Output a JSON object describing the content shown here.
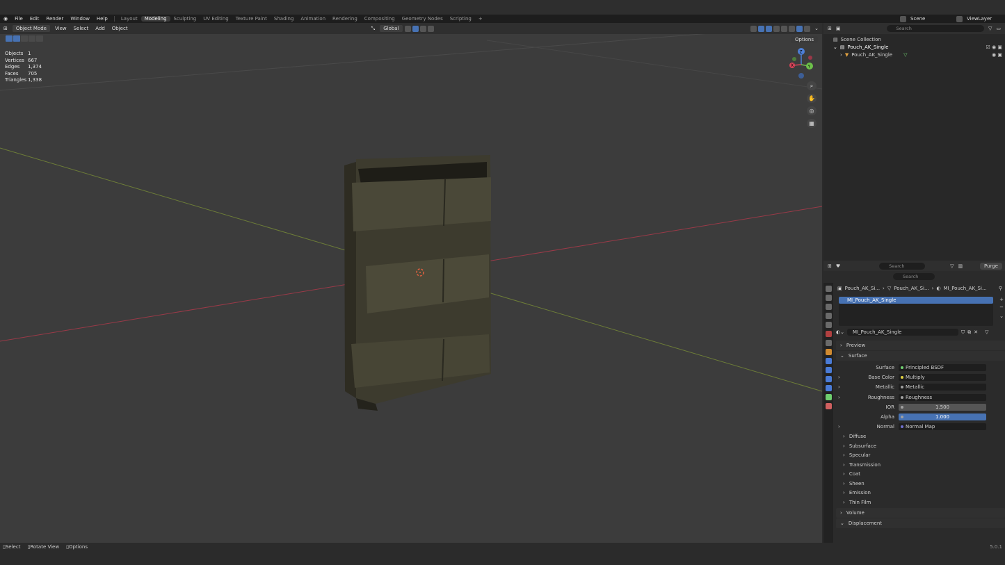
{
  "menubar": {
    "menus": [
      "File",
      "Edit",
      "Render",
      "Window",
      "Help"
    ],
    "workspaces": [
      "Layout",
      "Modeling",
      "Sculpting",
      "UV Editing",
      "Texture Paint",
      "Shading",
      "Animation",
      "Rendering",
      "Compositing",
      "Geometry Nodes",
      "Scripting"
    ],
    "active_workspace": "Modeling",
    "add_tab": "+",
    "scene": "Scene",
    "view_layer": "ViewLayer"
  },
  "viewport": {
    "mode": "Object Mode",
    "menus": [
      "View",
      "Select",
      "Add",
      "Object"
    ],
    "orientation": "Global",
    "options": "Options",
    "stats": [
      {
        "k": "Objects",
        "v": "1"
      },
      {
        "k": "Vertices",
        "v": "667"
      },
      {
        "k": "Edges",
        "v": "1,374"
      },
      {
        "k": "Faces",
        "v": "705"
      },
      {
        "k": "Triangles",
        "v": "1,338"
      }
    ],
    "gizmo_labels": {
      "z": "Z",
      "y": "Y",
      "x": "X"
    },
    "nav_icons": [
      "zoom-icon",
      "hand-pan-icon",
      "camera-icon",
      "grid-ortho-icon"
    ]
  },
  "outliner": {
    "search_placeholder": "Search",
    "scene_collection": "Scene Collection",
    "collection": "Pouch_AK_Single",
    "object": "Pouch_AK_Single"
  },
  "properties": {
    "search_placeholder": "Search",
    "purge": "Purge",
    "search2": "Search",
    "breadcrumb": [
      "Pouch_AK_Si...",
      "Pouch_AK_Si...",
      "MI_Pouch_AK_Si..."
    ],
    "material_slot": "MI_Pouch_AK_Single",
    "material_name": "MI_Pouch_AK_Single",
    "panels": {
      "preview": "Preview",
      "surface": "Surface",
      "volume": "Volume",
      "displacement": "Displacement"
    },
    "surface_rows": [
      {
        "label": "Surface",
        "value": "Principled BSDF",
        "dot": "#6fcf6f",
        "kind": "link"
      },
      {
        "label": "Base Color",
        "value": "Multiply",
        "dot": "#e0d040",
        "kind": "link"
      },
      {
        "label": "Metallic",
        "value": "Metallic",
        "dot": "#a0a0a0",
        "kind": "link"
      },
      {
        "label": "Roughness",
        "value": "Roughness",
        "dot": "#a0a0a0",
        "kind": "link"
      },
      {
        "label": "IOR",
        "value": "1.500",
        "dot": "#a0a0a0",
        "kind": "num"
      },
      {
        "label": "Alpha",
        "value": "1.000",
        "dot": "#a0a0a0",
        "kind": "blue"
      },
      {
        "label": "Normal",
        "value": "Normal Map",
        "dot": "#7070d0",
        "kind": "link"
      }
    ],
    "subpanels": [
      "Diffuse",
      "Subsurface",
      "Specular",
      "Transmission",
      "Coat",
      "Sheen",
      "Emission",
      "Thin Film"
    ]
  },
  "status": {
    "items": [
      "Select",
      "Rotate View",
      "Options"
    ],
    "version": "5.0.1"
  }
}
